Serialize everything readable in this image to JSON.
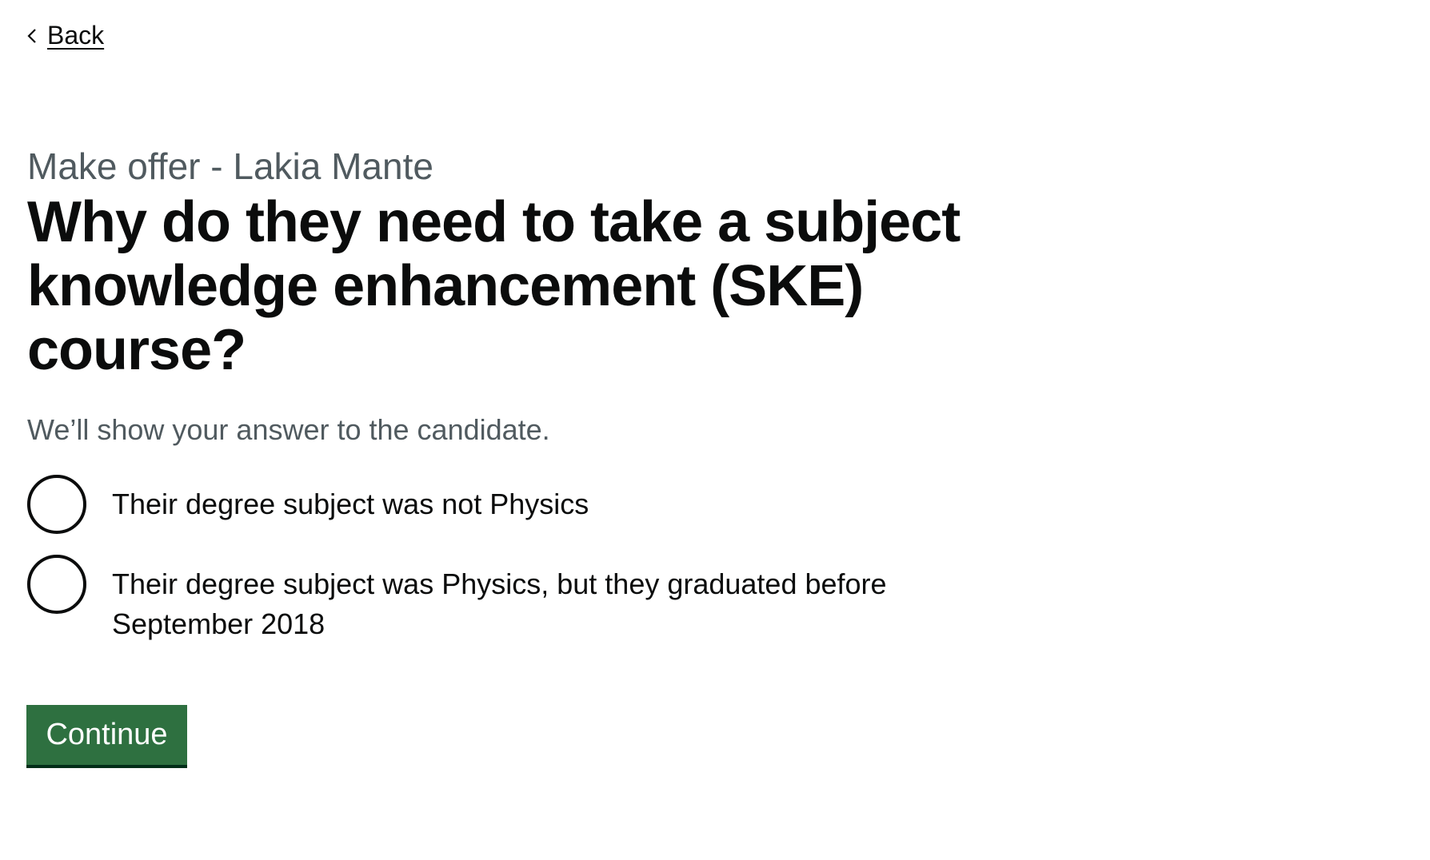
{
  "back_link": {
    "label": "Back",
    "icon": "chevron-left-icon"
  },
  "caption": "Make offer - Lakia Mante",
  "heading": "Why do they need to take a subject knowledge enhancement (SKE) course?",
  "hint": "We’ll show your answer to the candidate.",
  "options": [
    {
      "label": "Their degree subject was not Physics",
      "selected": false
    },
    {
      "label": "Their degree subject was Physics, but they graduated before September 2018",
      "selected": false
    }
  ],
  "continue_button": {
    "label": "Continue",
    "color": "#2e7040"
  },
  "colors": {
    "text": "#0b0c0c",
    "secondary_text": "#505a5f",
    "button": "#2e7040",
    "button_shadow": "#002d18"
  }
}
